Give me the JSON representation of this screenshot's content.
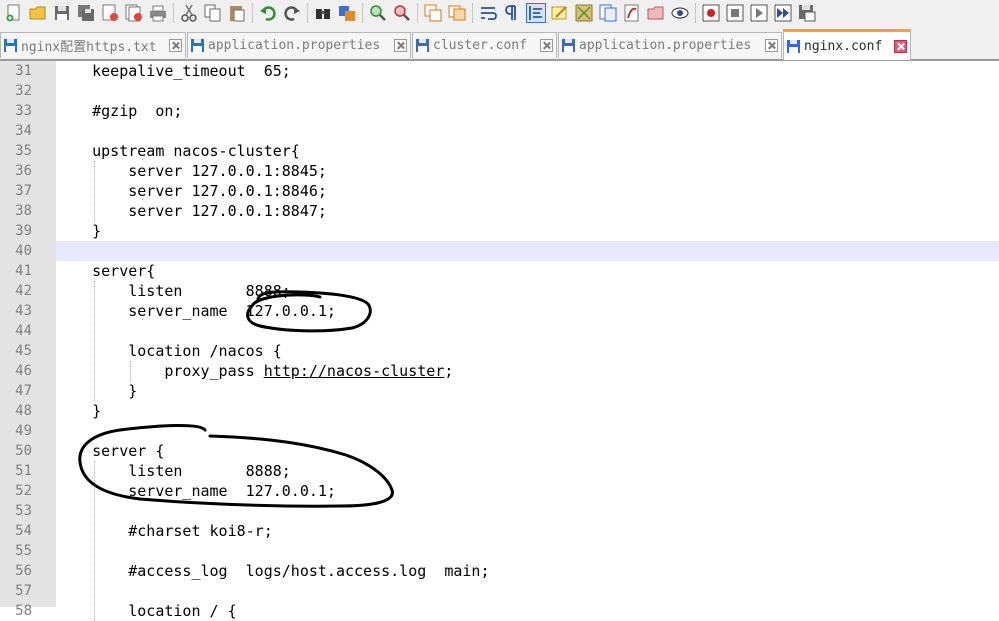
{
  "toolbar": {
    "buttons": [
      "new-file-icon",
      "open-file-icon",
      "save-icon",
      "save-all-icon",
      "close-icon",
      "close-all-icon",
      "print-icon",
      "cut-icon",
      "copy-icon",
      "paste-icon",
      "undo-icon",
      "redo-icon",
      "find-icon",
      "replace-icon",
      "zoom-in-icon",
      "zoom-out-icon",
      "sync-vertical-icon",
      "sync-horizontal-icon",
      "word-wrap-icon",
      "show-all-chars-icon",
      "indent-guide-icon",
      "user-language-icon",
      "doc-map-icon",
      "function-list-icon",
      "folder-workspace-icon",
      "monitor-icon",
      "record-macro-icon",
      "stop-record-icon",
      "play-macro-icon",
      "run-macro-multiple-icon",
      "save-macro-icon"
    ]
  },
  "tabs": [
    {
      "label": "nginx配置https.txt",
      "active": false
    },
    {
      "label": "application.properties",
      "active": false
    },
    {
      "label": "cluster.conf",
      "active": false
    },
    {
      "label": "application.properties",
      "active": false
    },
    {
      "label": "nginx.conf",
      "active": true
    }
  ],
  "editor": {
    "current_line": 40,
    "lines": [
      {
        "n": "31",
        "text": "    keepalive_timeout  65;"
      },
      {
        "n": "32",
        "text": ""
      },
      {
        "n": "33",
        "text": "    #gzip  on;"
      },
      {
        "n": "34",
        "text": ""
      },
      {
        "n": "35",
        "text": "    upstream nacos-cluster{"
      },
      {
        "n": "36",
        "text": "        server 127.0.0.1:8845;"
      },
      {
        "n": "37",
        "text": "        server 127.0.0.1:8846;"
      },
      {
        "n": "38",
        "text": "        server 127.0.0.1:8847;"
      },
      {
        "n": "39",
        "text": "    }"
      },
      {
        "n": "40",
        "text": ""
      },
      {
        "n": "41",
        "text": "    server{"
      },
      {
        "n": "42",
        "text": "        listen       8888;"
      },
      {
        "n": "43",
        "text": "        server_name  127.0.0.1;"
      },
      {
        "n": "44",
        "text": ""
      },
      {
        "n": "45",
        "text": "        location /nacos {"
      },
      {
        "n": "46",
        "pre": "            proxy_pass ",
        "url": "http://nacos-cluster",
        "post": ";"
      },
      {
        "n": "47",
        "text": "        }"
      },
      {
        "n": "48",
        "text": "    }"
      },
      {
        "n": "49",
        "text": ""
      },
      {
        "n": "50",
        "text": "    server {"
      },
      {
        "n": "51",
        "text": "        listen       8888;"
      },
      {
        "n": "52",
        "text": "        server_name  127.0.0.1;"
      },
      {
        "n": "53",
        "text": ""
      },
      {
        "n": "54",
        "text": "        #charset koi8-r;"
      },
      {
        "n": "55",
        "text": ""
      },
      {
        "n": "56",
        "text": "        #access_log  logs/host.access.log  main;"
      },
      {
        "n": "57",
        "text": ""
      },
      {
        "n": "58",
        "text": "        location / {"
      }
    ]
  },
  "colors": {
    "current_line_bg": "#e8e8ff",
    "gutter_bg": "#e4e4e4",
    "active_tab_accent": "#f9a24a",
    "annotation_ink": "#000000"
  }
}
